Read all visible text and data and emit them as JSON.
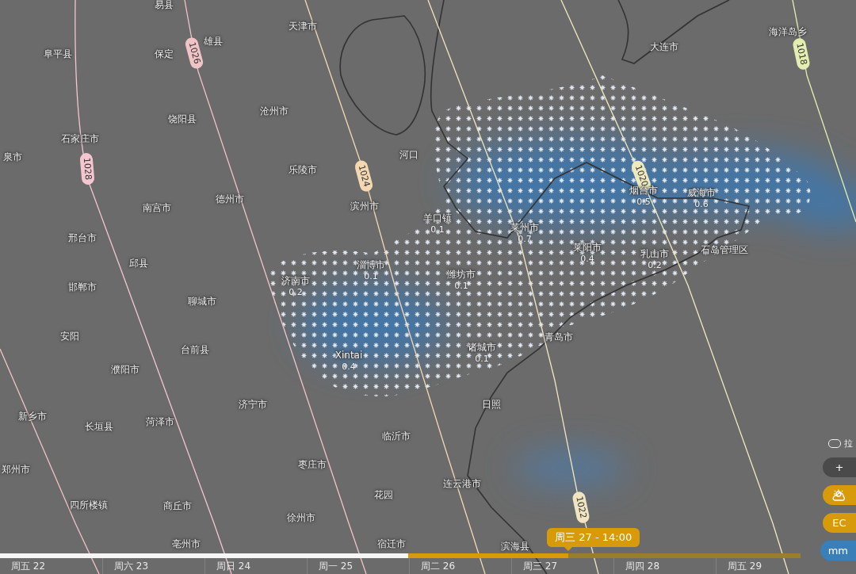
{
  "map": {
    "cities": [
      {
        "name": "易县"
      },
      {
        "name": "天津市"
      },
      {
        "name": "海洋岛乡"
      },
      {
        "name": "雄县"
      },
      {
        "name": "大连市"
      },
      {
        "name": "阜平县"
      },
      {
        "name": "保定"
      },
      {
        "name": "饶阳县"
      },
      {
        "name": "沧州市"
      },
      {
        "name": "石家庄市"
      },
      {
        "name": "泉市"
      },
      {
        "name": "河口"
      },
      {
        "name": "乐陵市"
      },
      {
        "name": "南宫市"
      },
      {
        "name": "德州市"
      },
      {
        "name": "滨州市"
      },
      {
        "name": "烟台市",
        "precip": "0.5"
      },
      {
        "name": "威海市",
        "precip": "0.6"
      },
      {
        "name": "邢台市"
      },
      {
        "name": "羊口镇",
        "precip": "0.1"
      },
      {
        "name": "莱州市",
        "precip": "0.7"
      },
      {
        "name": "邱县"
      },
      {
        "name": "淄博市",
        "precip": "0.1"
      },
      {
        "name": "莱阳市",
        "precip": "0.4"
      },
      {
        "name": "乳山市",
        "precip": "0.2"
      },
      {
        "name": "石岛管理区"
      },
      {
        "name": "邯郸市"
      },
      {
        "name": "济南市",
        "precip": "0.2"
      },
      {
        "name": "潍坊市",
        "precip": "0.1"
      },
      {
        "name": "聊城市"
      },
      {
        "name": "安阳"
      },
      {
        "name": "青岛市"
      },
      {
        "name": "台前县"
      },
      {
        "name": "Xintai",
        "precip": "0.4"
      },
      {
        "name": "诸城市",
        "precip": "0.1"
      },
      {
        "name": "濮阳市"
      },
      {
        "name": "济宁市"
      },
      {
        "name": "日照"
      },
      {
        "name": "新乡市"
      },
      {
        "name": "长垣县"
      },
      {
        "name": "菏泽市"
      },
      {
        "name": "临沂市"
      },
      {
        "name": "郑州市"
      },
      {
        "name": "枣庄市"
      },
      {
        "name": "连云港市"
      },
      {
        "name": "花园"
      },
      {
        "name": "四所楼镇"
      },
      {
        "name": "商丘市"
      },
      {
        "name": "徐州市"
      },
      {
        "name": "亳州市"
      },
      {
        "name": "宿迁市"
      },
      {
        "name": "滨海县"
      }
    ],
    "isobars": [
      {
        "label": "1026",
        "color": "#f0c4c6"
      },
      {
        "label": "1018",
        "color": "#e4eeb0"
      },
      {
        "label": "1028",
        "color": "#f3c6d0"
      },
      {
        "label": "1024",
        "color": "#f3d8b2"
      },
      {
        "label": "1020",
        "color": "#efeabe"
      },
      {
        "label": "1022",
        "color": "#f1e4c0"
      }
    ]
  },
  "controls": {
    "toggle": {
      "label": "拉",
      "on": false
    },
    "buttons": [
      {
        "kind": "plus",
        "label": "+"
      },
      {
        "kind": "layer"
      },
      {
        "kind": "model",
        "label": "EC"
      },
      {
        "kind": "unit",
        "label": "mm"
      }
    ]
  },
  "timeline": {
    "cursor_label": "周三 27 - 14:00",
    "loaded": {
      "level": 0.51
    },
    "cursor": {
      "level": 0.71
    },
    "days": [
      "周五 22",
      "周六 23",
      "周日 24",
      "周一 25",
      "周二 26",
      "周三 27",
      "周四 28",
      "周五 29"
    ]
  }
}
